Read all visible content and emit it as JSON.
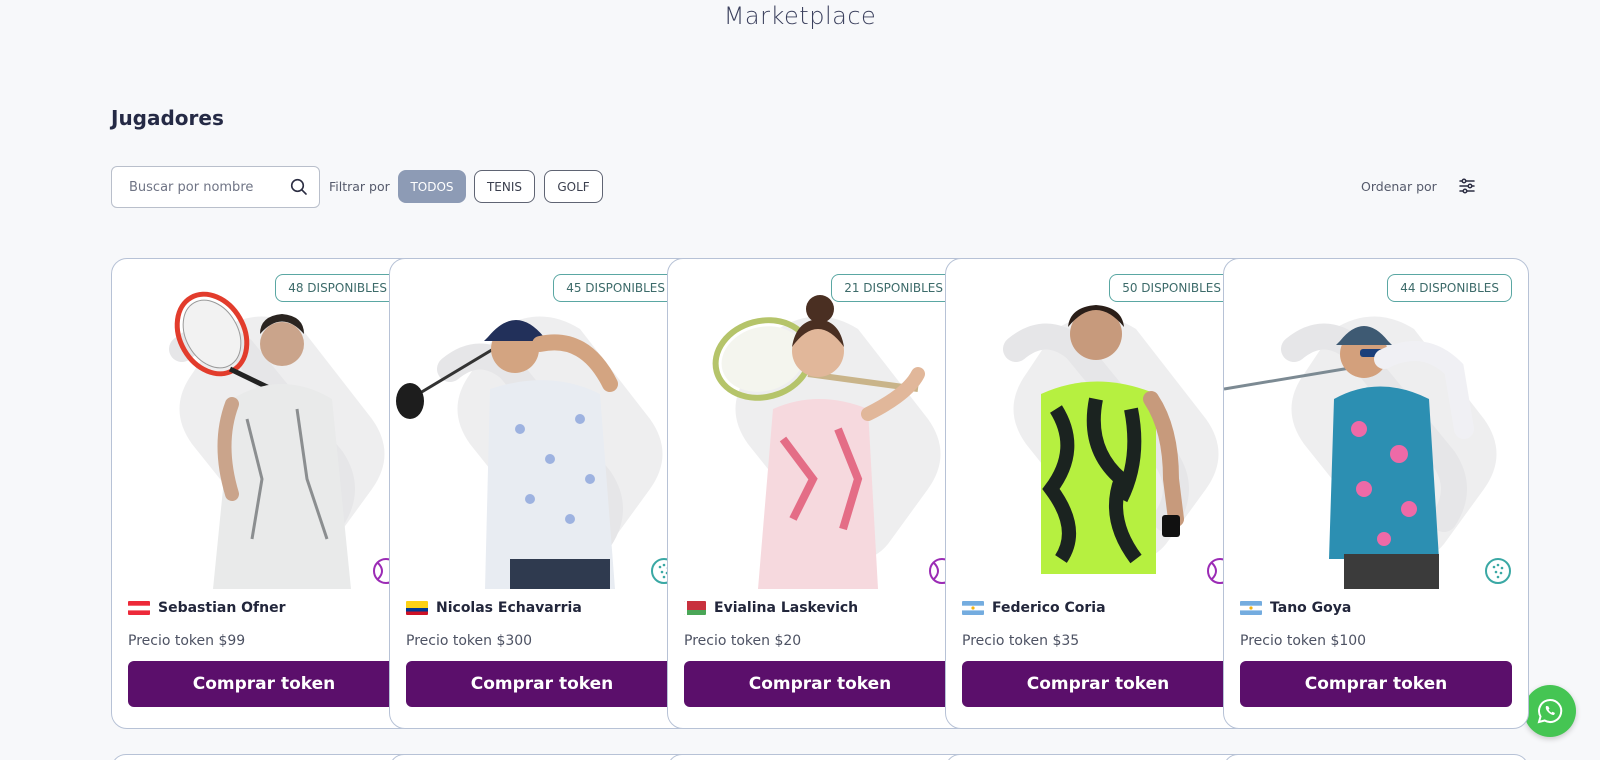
{
  "page": {
    "title": "Marketplace"
  },
  "section": {
    "title": "Jugadores"
  },
  "search": {
    "placeholder": "Buscar por nombre"
  },
  "filters": {
    "label": "Filtrar por",
    "options": [
      "TODOS",
      "TENIS",
      "GOLF"
    ],
    "selected": "TODOS"
  },
  "sort": {
    "label": "Ordenar por"
  },
  "cards": [
    {
      "available": "48 DISPONIBLES",
      "name": "Sebastian Ofner",
      "country": "Austria",
      "price": "Precio token $99",
      "button": "Comprar token",
      "sport": "tennis-icon"
    },
    {
      "available": "45 DISPONIBLES",
      "name": "Nicolas Echavarria",
      "country": "Colombia",
      "price": "Precio token $300",
      "button": "Comprar token",
      "sport": "golf-icon"
    },
    {
      "available": "21 DISPONIBLES",
      "name": "Evialina Laskevich",
      "country": "Belarus",
      "price": "Precio token $20",
      "button": "Comprar token",
      "sport": "tennis-icon"
    },
    {
      "available": "50 DISPONIBLES",
      "name": "Federico Coria",
      "country": "Argentina",
      "price": "Precio token $35",
      "button": "Comprar token",
      "sport": "tennis-icon"
    },
    {
      "available": "44 DISPONIBLES",
      "name": "Tano Goya",
      "country": "Argentina",
      "price": "Precio token $100",
      "button": "Comprar token",
      "sport": "golf-icon"
    }
  ],
  "colors": {
    "primary": "#5b0f6b",
    "badge_border": "#5aa7a3",
    "tennis": "#9b2bb5",
    "golf": "#3aa8a4",
    "whatsapp": "#45c553"
  }
}
